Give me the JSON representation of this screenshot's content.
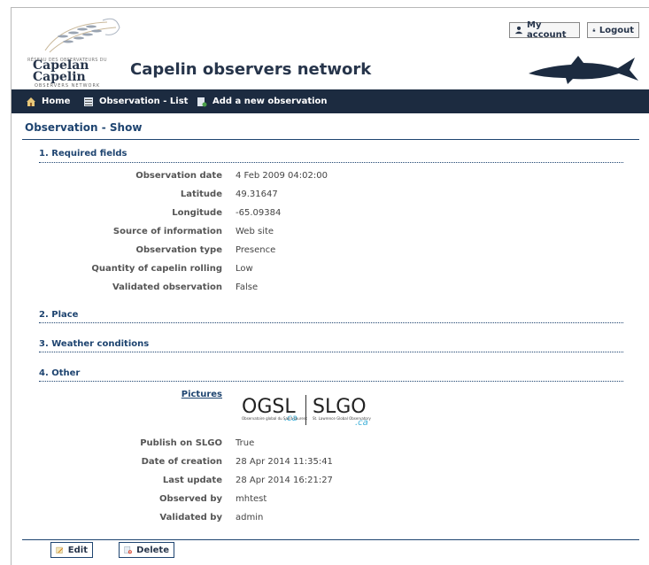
{
  "header": {
    "logo_top": "RÉSEAU DES OBSERVATEURS DU",
    "logo_brand1": "Capelan",
    "logo_brand2": "Capelin",
    "logo_sub": "OBSERVERS NETWORK",
    "title": "Capelin observers network",
    "my_account": "My account",
    "logout": "Logout"
  },
  "nav": {
    "home": "Home",
    "observation_list": "Observation - List",
    "add_observation": "Add a new observation"
  },
  "page_title": "Observation - Show",
  "sections": {
    "required": "1. Required fields",
    "place": "2. Place",
    "weather": "3. Weather conditions",
    "other": "4. Other"
  },
  "required_fields": [
    {
      "label": "Observation date",
      "value": "4 Feb 2009 04:02:00"
    },
    {
      "label": "Latitude",
      "value": "49.31647"
    },
    {
      "label": "Longitude",
      "value": "-65.09384"
    },
    {
      "label": "Source of information",
      "value": "Web site"
    },
    {
      "label": "Observation type",
      "value": "Presence"
    },
    {
      "label": "Quantity of capelin rolling",
      "value": "Low"
    },
    {
      "label": "Validated observation",
      "value": "False"
    }
  ],
  "other": {
    "pictures_label": "Pictures",
    "ogsl_text": "OGSL",
    "slgo_text": "SLGO",
    "ca_text": ".ca",
    "ogsl_sub": "Observatoire global du Saint-Laurent",
    "slgo_sub": "St. Lawrence Global Observatory",
    "fields": [
      {
        "label": "Publish on SLGO",
        "value": "True"
      },
      {
        "label": "Date of creation",
        "value": "28 Apr 2014 11:35:41"
      },
      {
        "label": "Last update",
        "value": "28 Apr 2014 16:21:27"
      },
      {
        "label": "Observed by",
        "value": "mhtest"
      },
      {
        "label": "Validated by",
        "value": "admin"
      }
    ]
  },
  "actions": {
    "edit": "Edit",
    "delete": "Delete"
  },
  "colors": {
    "navbar": "#1c2b40",
    "accent": "#1e4470",
    "brand": "#27354b"
  }
}
